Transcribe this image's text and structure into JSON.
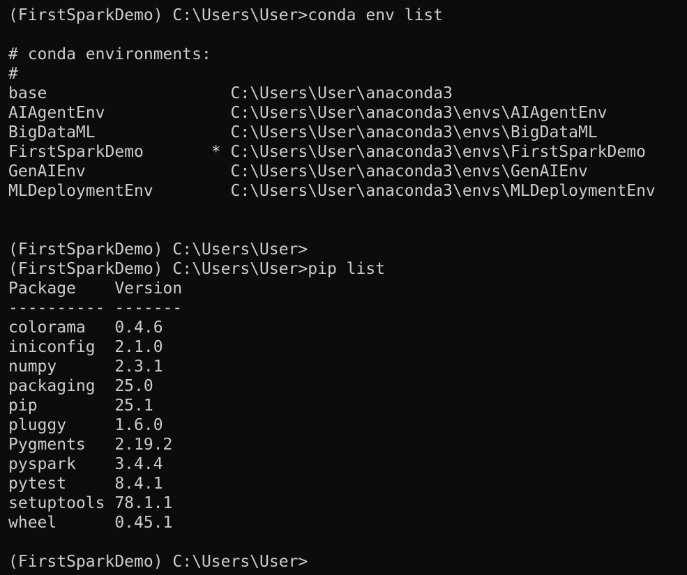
{
  "terminal": {
    "lines": [
      "(FirstSparkDemo) C:\\Users\\User>conda env list",
      "",
      "# conda environments:",
      "#",
      "base                   C:\\Users\\User\\anaconda3",
      "AIAgentEnv             C:\\Users\\User\\anaconda3\\envs\\AIAgentEnv",
      "BigDataML              C:\\Users\\User\\anaconda3\\envs\\BigDataML",
      "FirstSparkDemo       * C:\\Users\\User\\anaconda3\\envs\\FirstSparkDemo",
      "GenAIEnv               C:\\Users\\User\\anaconda3\\envs\\GenAIEnv",
      "MLDeploymentEnv        C:\\Users\\User\\anaconda3\\envs\\MLDeploymentEnv",
      "",
      "",
      "(FirstSparkDemo) C:\\Users\\User>",
      "(FirstSparkDemo) C:\\Users\\User>pip list",
      "Package    Version",
      "---------- -------",
      "colorama   0.4.6",
      "iniconfig  2.1.0",
      "numpy      2.3.1",
      "packaging  25.0",
      "pip        25.1",
      "pluggy     1.6.0",
      "Pygments   2.19.2",
      "pyspark    3.4.4",
      "pytest     8.4.1",
      "setuptools 78.1.1",
      "wheel      0.45.1",
      "",
      "(FirstSparkDemo) C:\\Users\\User>"
    ]
  }
}
